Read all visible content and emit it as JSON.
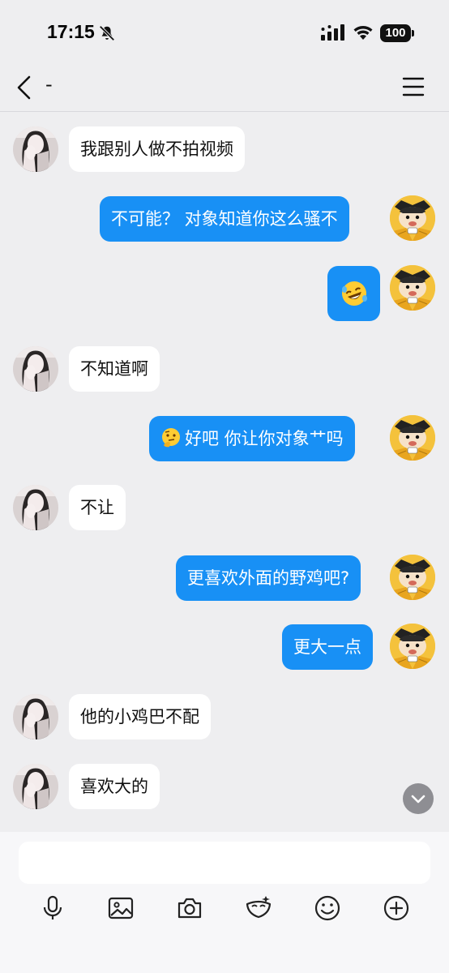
{
  "status_bar": {
    "time": "17:15",
    "battery": "100",
    "icons": [
      "bell-slash-icon",
      "signal-icon",
      "wifi-icon",
      "battery-icon"
    ]
  },
  "nav": {
    "title": "-",
    "back_icon": "chevron-left-icon",
    "menu_icon": "hamburger-menu-icon"
  },
  "messages": [
    {
      "side": "left",
      "text": "我跟别人做不拍视频"
    },
    {
      "side": "right",
      "text": "不可能？ 对象知道你这么骚不"
    },
    {
      "side": "right",
      "emoji": "rolling-on-floor-laughing-emoji"
    },
    {
      "side": "left",
      "text": "不知道啊"
    },
    {
      "side": "right",
      "emoji": "thinking-face-emoji",
      "text": "好吧  你让你对象艹吗"
    },
    {
      "side": "left",
      "text": "不让"
    },
    {
      "side": "right",
      "text": "更喜欢外面的野鸡吧?"
    },
    {
      "side": "right",
      "text": "更大一点"
    },
    {
      "side": "left",
      "text": "他的小鸡巴不配"
    },
    {
      "side": "left",
      "text": "喜欢大的"
    }
  ],
  "input": {
    "placeholder": "",
    "value": ""
  },
  "toolbar": [
    "microphone-icon",
    "image-icon",
    "camera-icon",
    "face-mask-icon",
    "emoji-icon",
    "plus-icon"
  ],
  "colors": {
    "background": "#EEEEF0",
    "sent_bubble": "#1890F5",
    "received_bubble": "#FFFFFF",
    "sent_text": "#FFFFFF",
    "received_text": "#111111"
  }
}
